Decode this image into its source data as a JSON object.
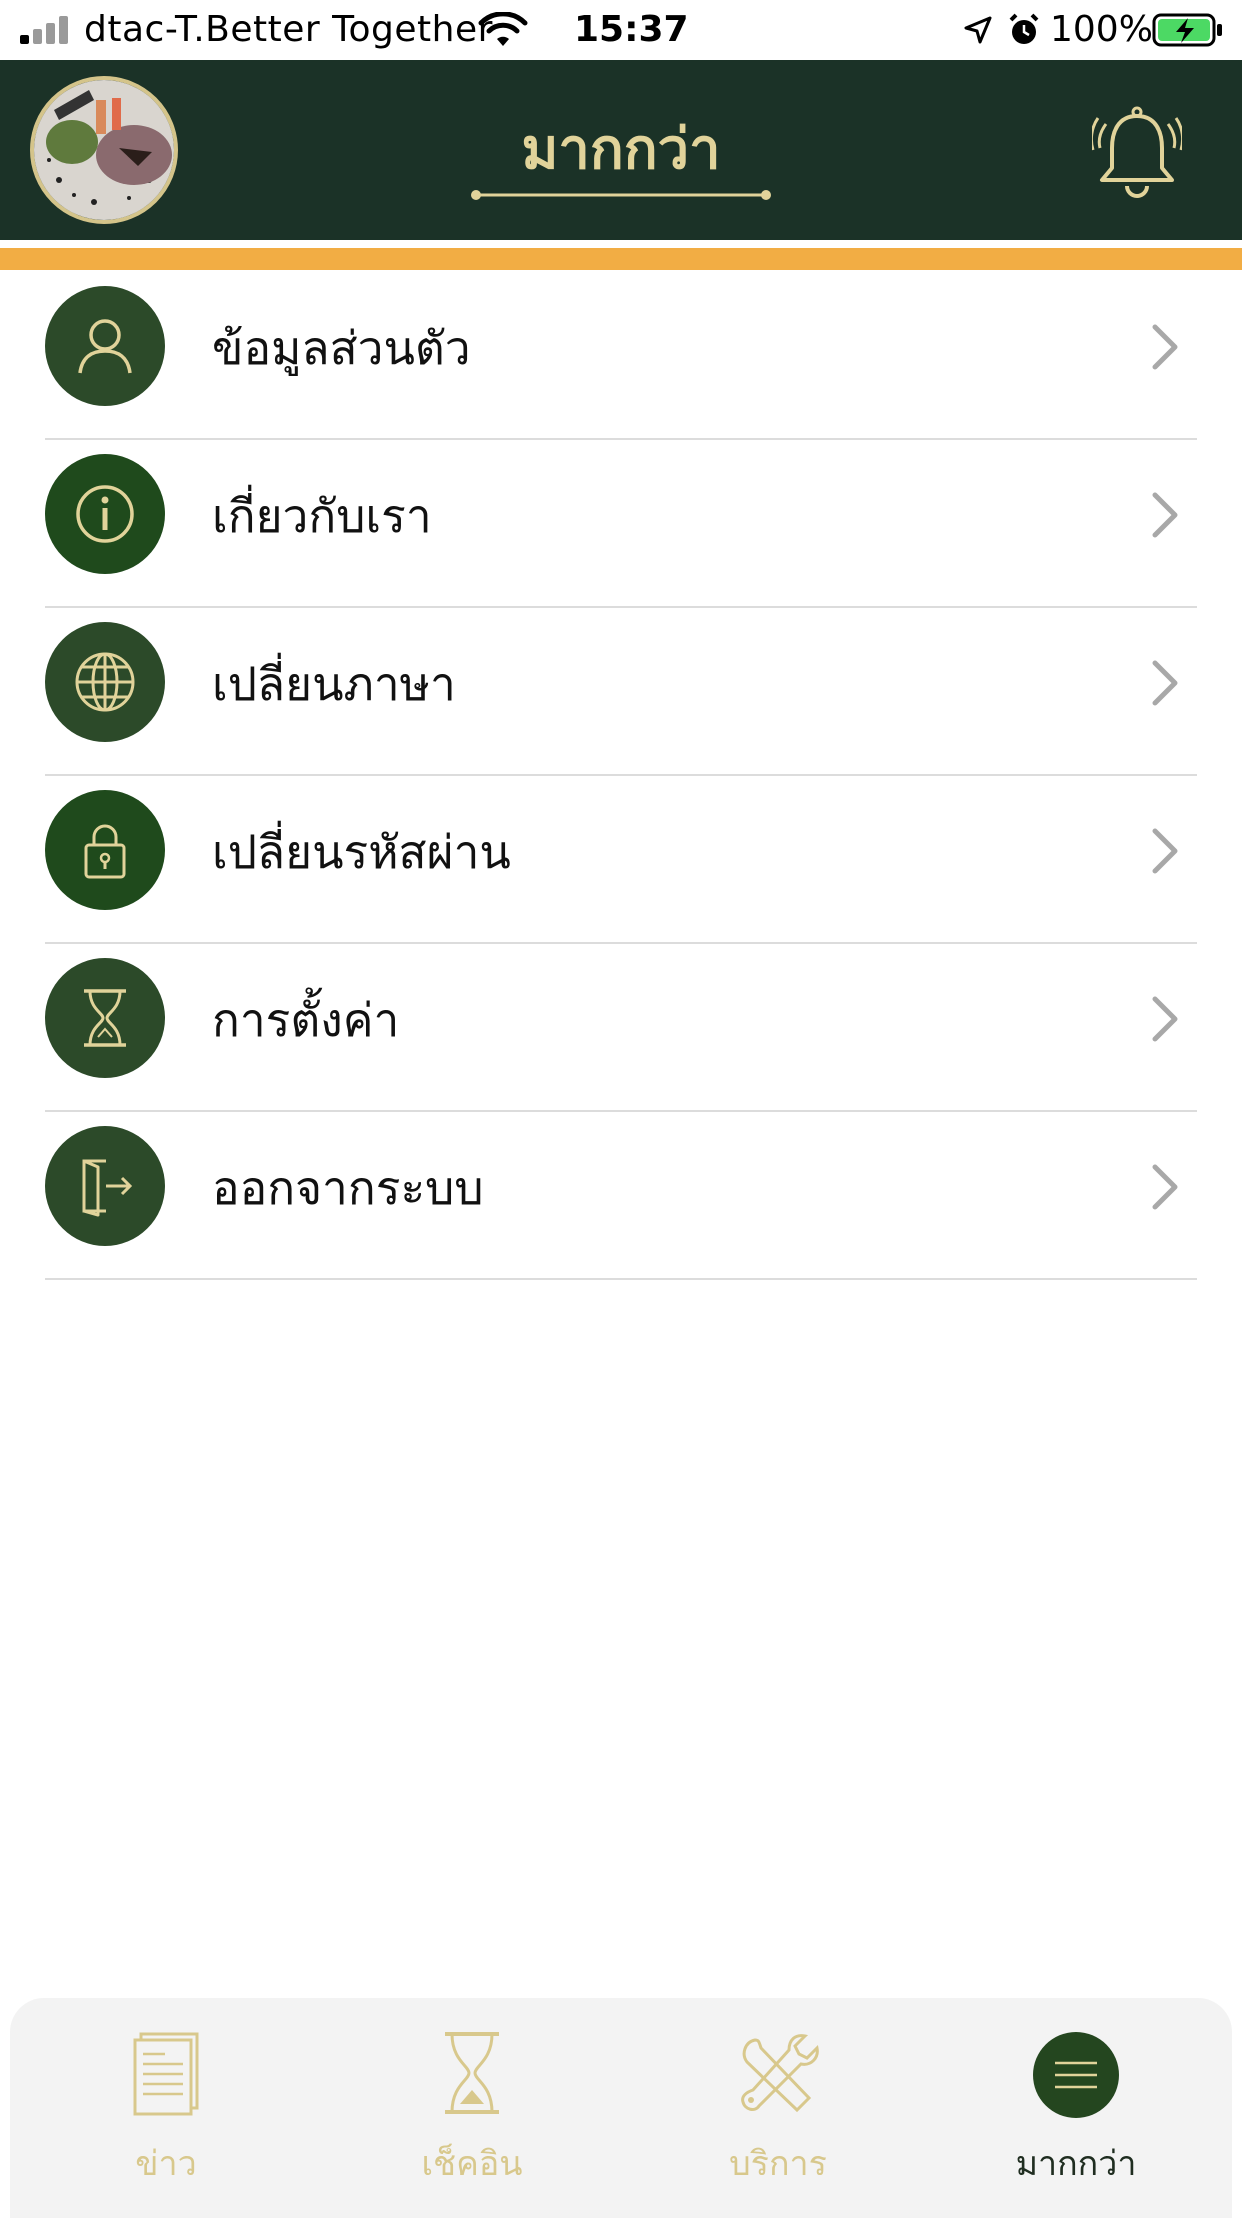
{
  "status_bar": {
    "carrier": "dtac-T.Better Together",
    "time": "15:37",
    "battery": "100%"
  },
  "header": {
    "title": "มากกว่า"
  },
  "colors": {
    "header_bg": "#1b3227",
    "gold": "#e1d39a",
    "accent_bar": "#f2ad44",
    "icon_circle": "#2c4a29"
  },
  "menu": {
    "items": [
      {
        "label": "ข้อมูลส่วนตัว",
        "icon": "person-icon"
      },
      {
        "label": "เกี่ยวกับเรา",
        "icon": "info-icon"
      },
      {
        "label": "เปลี่ยนภาษา",
        "icon": "globe-icon"
      },
      {
        "label": "เปลี่ยนรหัสผ่าน",
        "icon": "lock-icon"
      },
      {
        "label": "การตั้งค่า",
        "icon": "hourglass-icon"
      },
      {
        "label": "ออกจากระบบ",
        "icon": "logout-icon"
      }
    ]
  },
  "tab_bar": {
    "tabs": [
      {
        "label": "ข่าว",
        "icon": "news-icon",
        "active": false
      },
      {
        "label": "เช็คอิน",
        "icon": "hourglass-icon",
        "active": false
      },
      {
        "label": "บริการ",
        "icon": "tools-icon",
        "active": false
      },
      {
        "label": "มากกว่า",
        "icon": "menu-icon",
        "active": true
      }
    ]
  }
}
